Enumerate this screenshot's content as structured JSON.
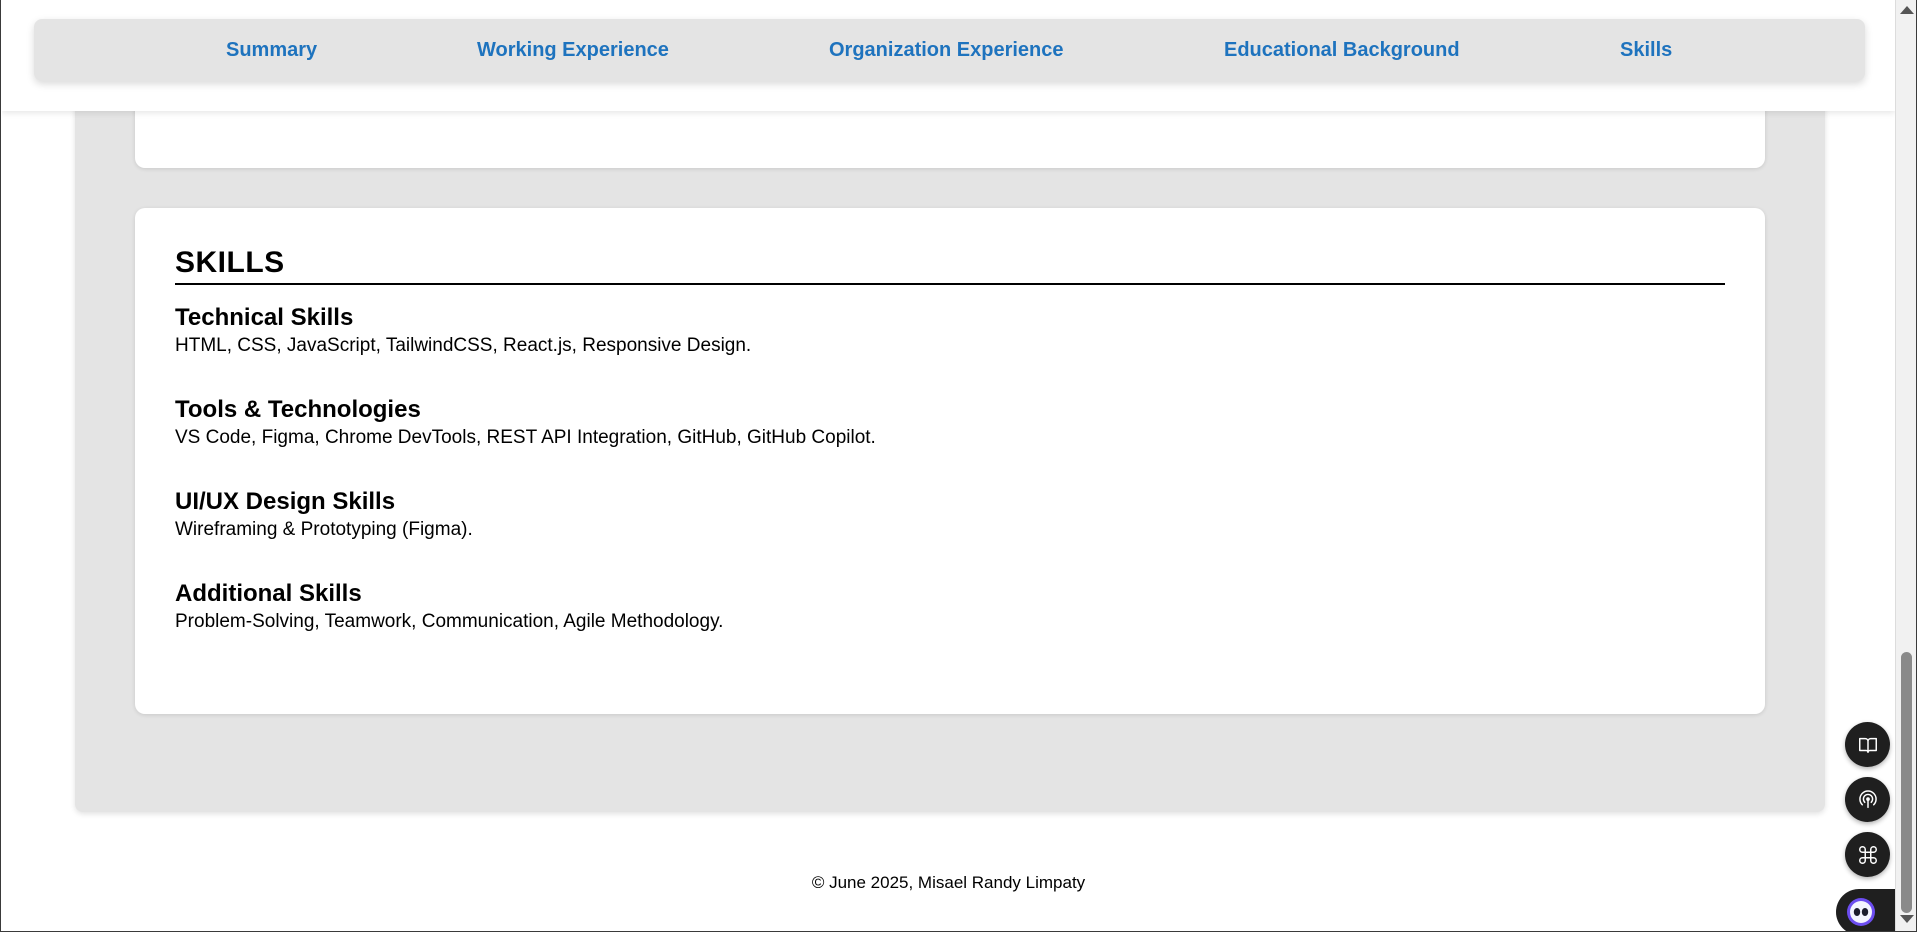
{
  "nav": {
    "items": [
      {
        "label": "Summary"
      },
      {
        "label": "Working Experience"
      },
      {
        "label": "Organization Experience"
      },
      {
        "label": "Educational Background"
      },
      {
        "label": "Skills"
      }
    ]
  },
  "skills": {
    "title": "SKILLS",
    "groups": [
      {
        "heading": "Technical Skills",
        "text": "HTML, CSS, JavaScript, TailwindCSS, React.js, Responsive Design."
      },
      {
        "heading": "Tools & Technologies",
        "text": "VS Code, Figma, Chrome DevTools, REST API Integration, GitHub, GitHub Copilot."
      },
      {
        "heading": "UI/UX Design Skills",
        "text": "Wireframing & Prototyping (Figma)."
      },
      {
        "heading": "Additional Skills",
        "text": "Problem-Solving, Teamwork, Communication, Agile Methodology."
      }
    ]
  },
  "footer": {
    "text": "© June 2025, Misael Randy Limpaty"
  },
  "floating_buttons": [
    {
      "icon": "book-open-icon"
    },
    {
      "icon": "broadcast-icon"
    },
    {
      "icon": "command-icon"
    },
    {
      "icon": "assistant-face-icon"
    }
  ]
}
